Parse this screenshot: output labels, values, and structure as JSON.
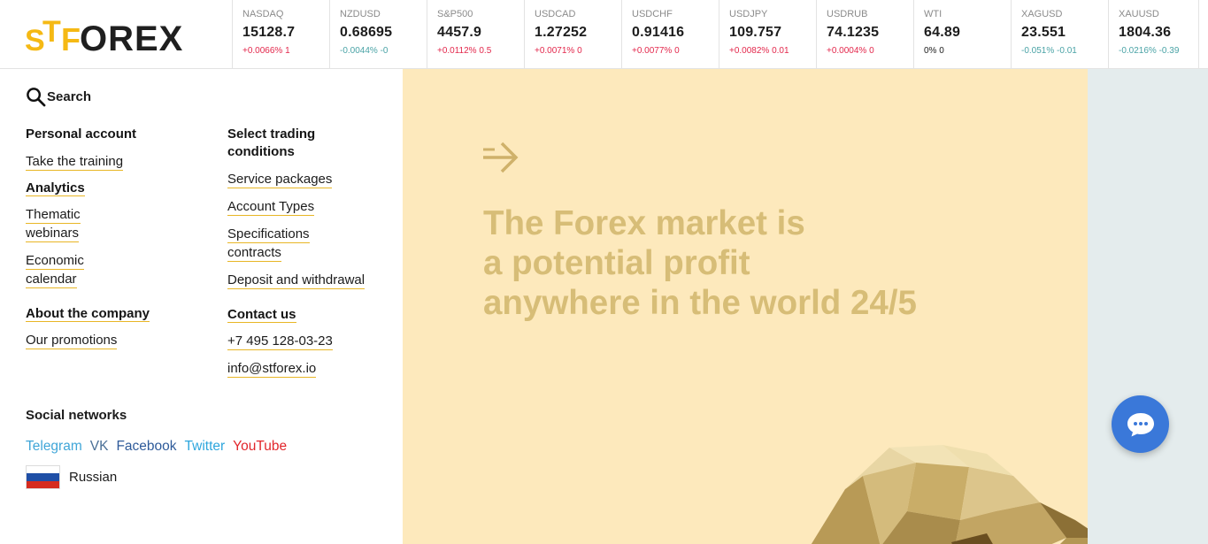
{
  "logo": {
    "text": "STFOREX"
  },
  "ticker": [
    {
      "name": "NASDAQ",
      "price": "15128.7",
      "change": "+0.0066% 1",
      "dir": "up"
    },
    {
      "name": "NZDUSD",
      "price": "0.68695",
      "change": "-0.0044% -0",
      "dir": "down"
    },
    {
      "name": "S&P500",
      "price": "4457.9",
      "change": "+0.0112% 0.5",
      "dir": "up"
    },
    {
      "name": "USDCAD",
      "price": "1.27252",
      "change": "+0.0071% 0",
      "dir": "up"
    },
    {
      "name": "USDCHF",
      "price": "0.91416",
      "change": "+0.0077% 0",
      "dir": "up"
    },
    {
      "name": "USDJPY",
      "price": "109.757",
      "change": "+0.0082% 0.01",
      "dir": "up"
    },
    {
      "name": "USDRUB",
      "price": "74.1235",
      "change": "+0.0004% 0",
      "dir": "up"
    },
    {
      "name": "WTI",
      "price": "64.89",
      "change": "0% 0",
      "dir": "flat"
    },
    {
      "name": "XAGUSD",
      "price": "23.551",
      "change": "-0.051% -0.01",
      "dir": "down"
    },
    {
      "name": "XAUUSD",
      "price": "1804.36",
      "change": "-0.0216% -0.39",
      "dir": "down"
    }
  ],
  "menu": {
    "search_label": "Search",
    "personal_account": "Personal account",
    "take_training": "Take the training",
    "analytics": "Analytics",
    "thematic_webinars_1": "Thematic",
    "thematic_webinars_2": "webinars",
    "economic_calendar_1": "Economic",
    "economic_calendar_2": "calendar",
    "about_company": "About the company",
    "our_promotions": "Our promotions",
    "select_trading_1": "Select trading",
    "select_trading_2": "conditions",
    "service_packages": "Service packages",
    "account_types": "Account Types",
    "specifications_1": "Specifications",
    "specifications_2": "contracts",
    "deposit_withdrawal": "Deposit and withdrawal",
    "contact_us": "Contact us",
    "phone": "+7 495 128-03-23",
    "email": "info@stforex.io",
    "social_head": "Social networks",
    "social": [
      {
        "label": "Telegram",
        "color": "#41a6d8"
      },
      {
        "label": "VK",
        "color": "#4a6f96"
      },
      {
        "label": "Facebook",
        "color": "#2f5b9a"
      },
      {
        "label": "Twitter",
        "color": "#2ea6dd"
      },
      {
        "label": "YouTube",
        "color": "#e2262b"
      }
    ],
    "language": "Russian"
  },
  "hero": {
    "line1": "The Forex market is",
    "line2": "a potential profit",
    "line3": "anywhere in the world 24/5"
  },
  "colors": {
    "accent": "#f5b914",
    "hero_bg": "#fde9bc",
    "hero_text": "#d7bd77",
    "side_bg": "#e4eced",
    "chat": "#3a78d9"
  }
}
